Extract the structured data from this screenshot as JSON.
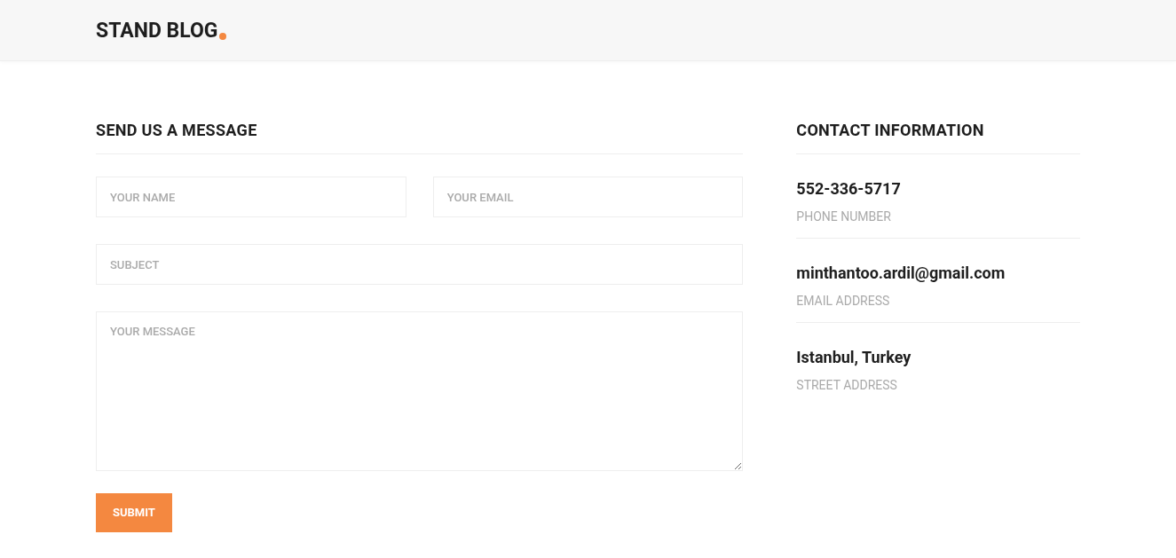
{
  "header": {
    "logo": "STAND BLOG"
  },
  "form": {
    "title": "SEND US A MESSAGE",
    "fields": [
      {
        "kind": "input",
        "placeholder": "YOUR NAME"
      },
      {
        "kind": "input",
        "placeholder": "YOUR EMAIL"
      },
      {
        "kind": "input-wide",
        "placeholder": "SUBJECT"
      },
      {
        "kind": "textarea",
        "placeholder": "YOUR MESSAGE"
      }
    ],
    "submit": "SUBMIT"
  },
  "contact": {
    "title": "CONTACT INFORMATION",
    "items": [
      {
        "value": "552-336-5717",
        "label": "PHONE NUMBER"
      },
      {
        "value": "minthantoo.ardil@gmail.com",
        "label": "EMAIL ADDRESS"
      },
      {
        "value": "Istanbul, Turkey",
        "label": "STREET ADDRESS"
      }
    ]
  }
}
